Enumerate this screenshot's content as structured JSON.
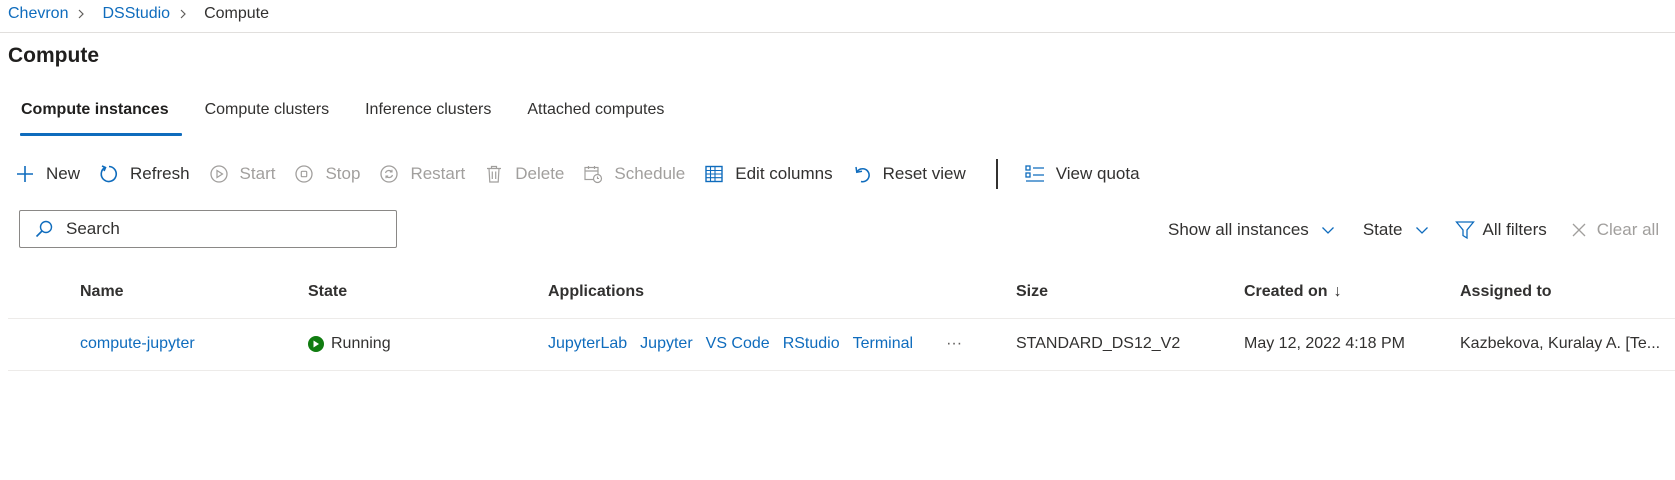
{
  "breadcrumb": {
    "items": [
      "Chevron",
      "DSStudio"
    ],
    "current": "Compute"
  },
  "page_title": "Compute",
  "tabs": [
    {
      "label": "Compute instances",
      "active": true
    },
    {
      "label": "Compute clusters",
      "active": false
    },
    {
      "label": "Inference clusters",
      "active": false
    },
    {
      "label": "Attached computes",
      "active": false
    }
  ],
  "toolbar": {
    "new": "New",
    "refresh": "Refresh",
    "start": "Start",
    "stop": "Stop",
    "restart": "Restart",
    "delete": "Delete",
    "schedule": "Schedule",
    "edit_columns": "Edit columns",
    "reset_view": "Reset view",
    "view_quota": "View quota"
  },
  "search": {
    "placeholder": "Search"
  },
  "filters": {
    "show_all": "Show all instances",
    "state": "State",
    "all_filters": "All filters",
    "clear_all": "Clear all"
  },
  "table": {
    "headers": {
      "name": "Name",
      "state": "State",
      "applications": "Applications",
      "size": "Size",
      "created_on": "Created on",
      "assigned_to": "Assigned to"
    },
    "sort_indicator": "↓",
    "rows": [
      {
        "name": "compute-jupyter",
        "state": "Running",
        "applications": [
          "JupyterLab",
          "Jupyter",
          "VS Code",
          "RStudio",
          "Terminal"
        ],
        "more": "···",
        "size": "STANDARD_DS12_V2",
        "created_on": "May 12, 2022 4:18 PM",
        "assigned_to": "Kazbekova, Kuralay A. [Te..."
      }
    ]
  },
  "colors": {
    "accent": "#0f6cbd",
    "running": "#107c10",
    "disabled_text": "#a19f9d"
  }
}
